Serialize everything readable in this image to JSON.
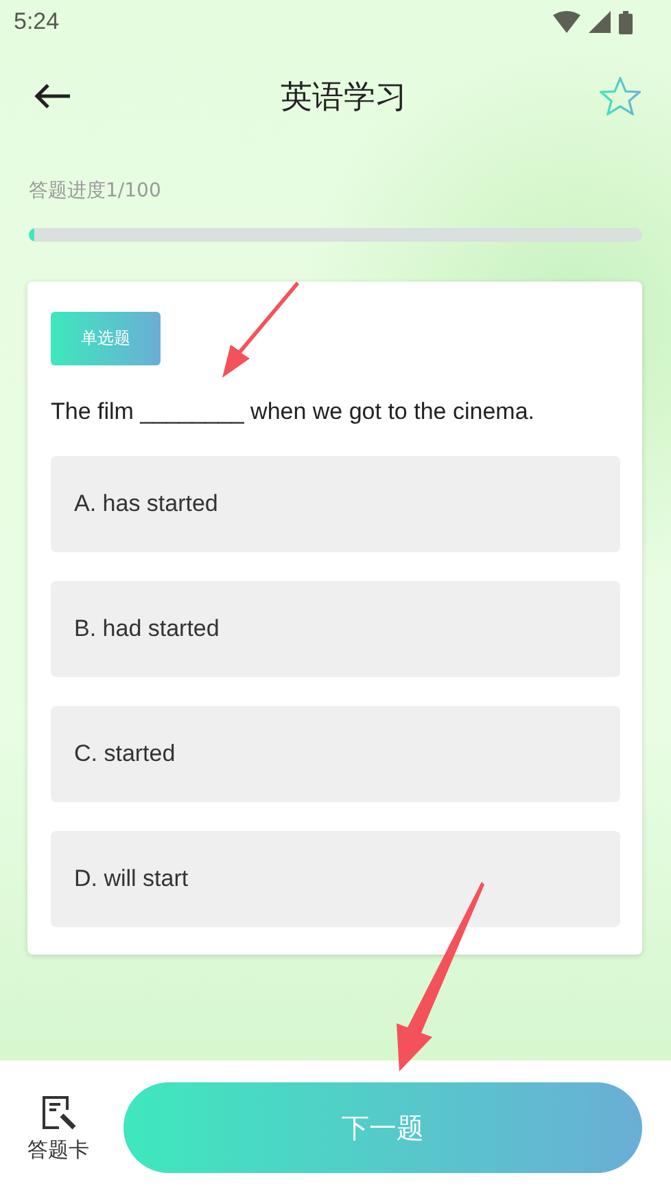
{
  "status_bar": {
    "time": "5:24"
  },
  "header": {
    "title": "英语学习",
    "favorited": false
  },
  "progress": {
    "label": "答题进度1/100",
    "level": 0.01
  },
  "question": {
    "tag": "单选题",
    "text": "The film ________ when we got to the cinema.",
    "options": [
      {
        "label": "A. has started",
        "selected": false
      },
      {
        "label": "B. had started",
        "selected": false
      },
      {
        "label": "C. started",
        "selected": false
      },
      {
        "label": "D. will start",
        "selected": false
      }
    ]
  },
  "bottom_bar": {
    "card_label": "答题卡",
    "next_button": "下一题"
  }
}
